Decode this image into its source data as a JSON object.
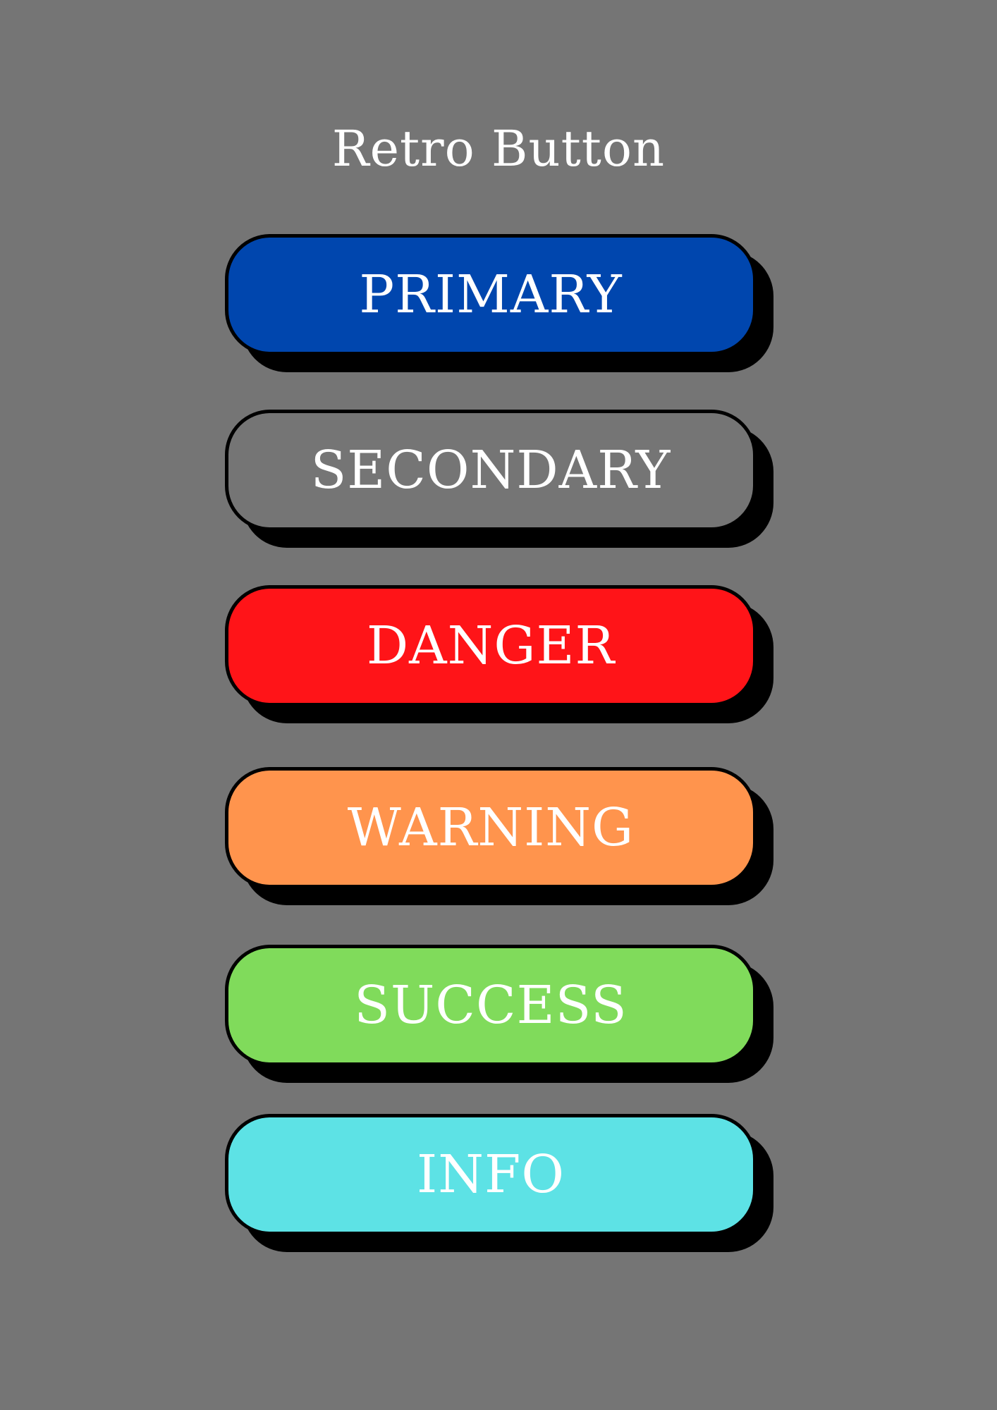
{
  "title": "Retro Button",
  "buttons": [
    {
      "label": "PRIMARY",
      "color": "#0046AE"
    },
    {
      "label": "SECONDARY",
      "color": "#757575"
    },
    {
      "label": "DANGER",
      "color": "#FF1418"
    },
    {
      "label": "WARNING",
      "color": "#FF944D"
    },
    {
      "label": "SUCCESS",
      "color": "#80DB5B"
    },
    {
      "label": "INFO",
      "color": "#5DE2E5"
    }
  ],
  "colors": {
    "background": "#757575",
    "border": "#000000",
    "text": "#FFFFFF"
  }
}
